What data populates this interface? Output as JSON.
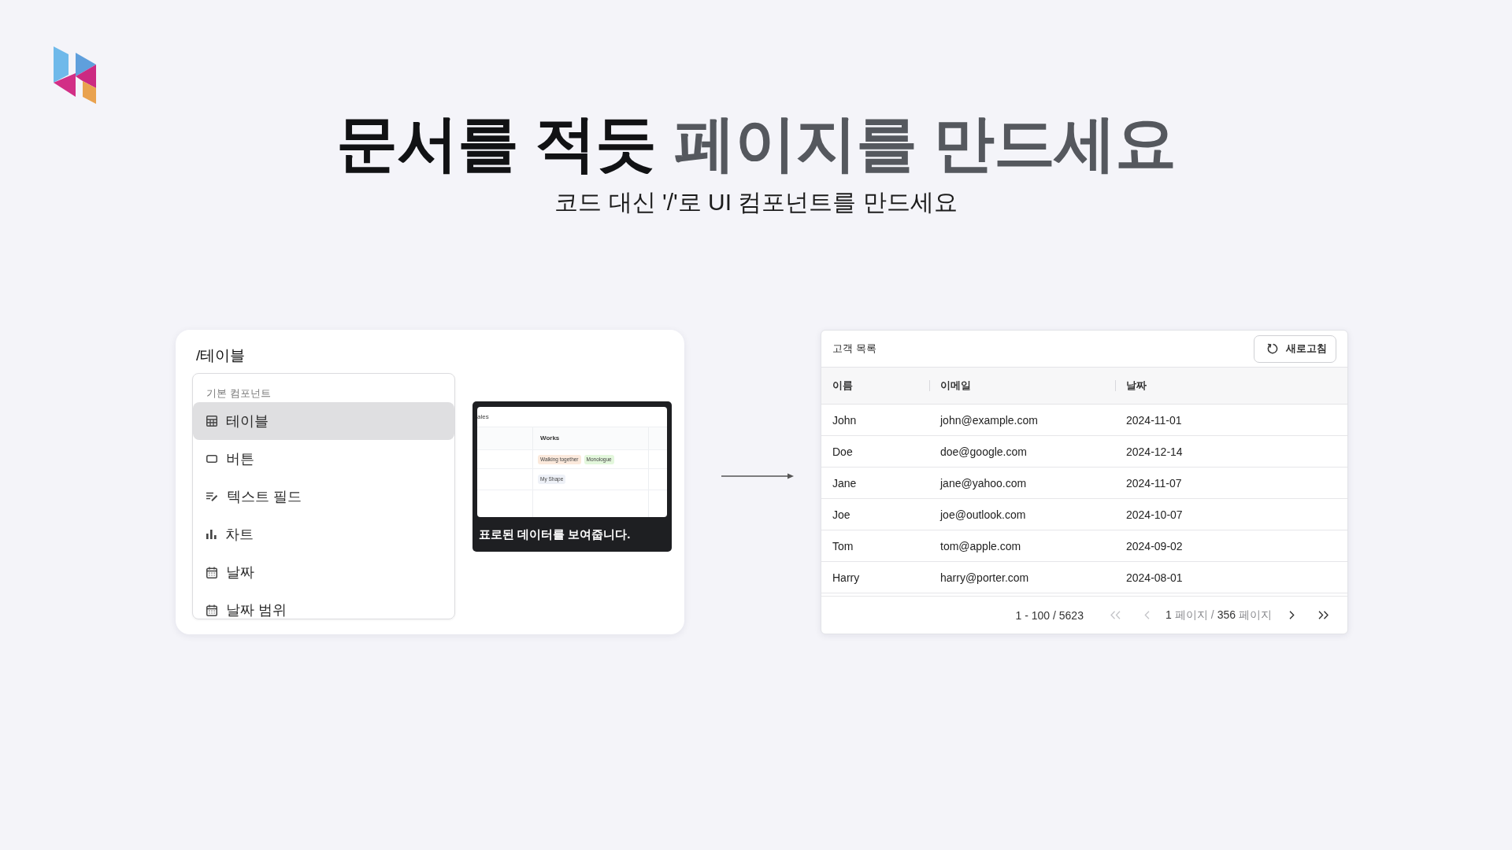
{
  "hero": {
    "title": [
      {
        "text": "문서를 적듯",
        "kind": "strong"
      },
      {
        "text": "페이지를 만드세요",
        "kind": "muted"
      }
    ],
    "subtitle": "코드 대신 '/'로 UI 컴포넌트를 만드세요"
  },
  "slash_menu": {
    "query": "/테이블",
    "section": "기본 컴포넌트",
    "items": [
      {
        "label": "테이블",
        "kind": "table",
        "selected": true
      },
      {
        "label": "버튼",
        "kind": "button",
        "selected": false
      },
      {
        "label": "텍스트 필드",
        "kind": "text-field",
        "selected": false
      },
      {
        "label": "차트",
        "kind": "chart",
        "selected": false
      },
      {
        "label": "날짜",
        "kind": "date",
        "selected": false
      },
      {
        "label": "날짜 범위",
        "kind": "date-range",
        "selected": false
      }
    ],
    "preview": {
      "snippet_title": "ales",
      "column": "Works",
      "rows": [
        {
          "tags": [
            {
              "label": "Walking together",
              "color": "#fbe9dc"
            },
            {
              "label": "Monologue",
              "color": "#e3f7dc"
            }
          ]
        },
        {
          "tags": [
            {
              "label": "My Shape",
              "color": "#eef1f7"
            }
          ]
        }
      ],
      "caption": "표로된 데이터를 보여줍니다."
    }
  },
  "customers": {
    "title": "고객 목록",
    "refresh_button": "새로고침",
    "columns": [
      "이름",
      "이메일",
      "날짜"
    ],
    "rows": [
      [
        "John",
        "john@example.com",
        "2024-11-01"
      ],
      [
        "Doe",
        "doe@google.com",
        "2024-12-14"
      ],
      [
        "Jane",
        "jane@yahoo.com",
        "2024-11-07"
      ],
      [
        "Joe",
        "joe@outlook.com",
        "2024-10-07"
      ],
      [
        "Tom",
        "tom@apple.com",
        "2024-09-02"
      ],
      [
        "Harry",
        "harry@porter.com",
        "2024-08-01"
      ]
    ],
    "pagination": {
      "range": "1 - 100 / 5623",
      "first": {
        "disabled": true
      },
      "prev": {
        "disabled": true
      },
      "page": [
        {
          "text": "1",
          "muted": false
        },
        {
          "text": "페이지",
          "muted": true
        },
        {
          "text": "/",
          "muted": true
        },
        {
          "text": "356",
          "muted": false
        },
        {
          "text": "페이지",
          "muted": true
        }
      ],
      "next": {
        "disabled": false
      },
      "last": {
        "disabled": false
      }
    }
  }
}
